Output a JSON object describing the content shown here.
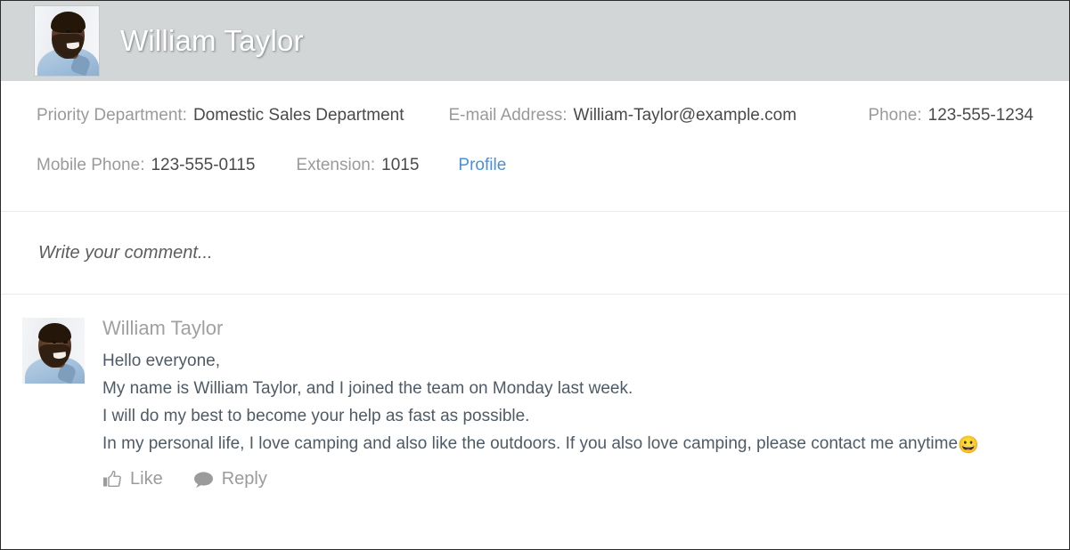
{
  "header": {
    "title": "William Taylor",
    "avatar_alt": "william-taylor-photo"
  },
  "info": {
    "priority_department": {
      "label": "Priority Department:",
      "value": "Domestic Sales Department"
    },
    "email": {
      "label": "E-mail Address:",
      "value": "William-Taylor@example.com"
    },
    "phone": {
      "label": "Phone:",
      "value": "123-555-1234"
    },
    "mobile_phone": {
      "label": "Mobile Phone:",
      "value": "123-555-0115"
    },
    "extension": {
      "label": "Extension:",
      "value": "1015"
    },
    "profile_link": "Profile"
  },
  "compose": {
    "placeholder": "Write your comment...",
    "value": ""
  },
  "comment": {
    "author": "William Taylor",
    "lines": [
      "Hello everyone,",
      "My name is William Taylor, and I joined the team on Monday last week.",
      "I will do my best to become your help as fast as possible.",
      "In my personal life, I love camping and also like the outdoors. If you also love camping, please contact me anytime"
    ],
    "emoji": "😀",
    "actions": {
      "like": "Like",
      "reply": "Reply"
    }
  },
  "colors": {
    "header_background": "#d2d6d7",
    "link": "#4a90d9",
    "label_text": "#9a9a9a",
    "value_text": "#4a4a4a",
    "body_text": "#4e5b66",
    "border": "#2b2b2b"
  }
}
